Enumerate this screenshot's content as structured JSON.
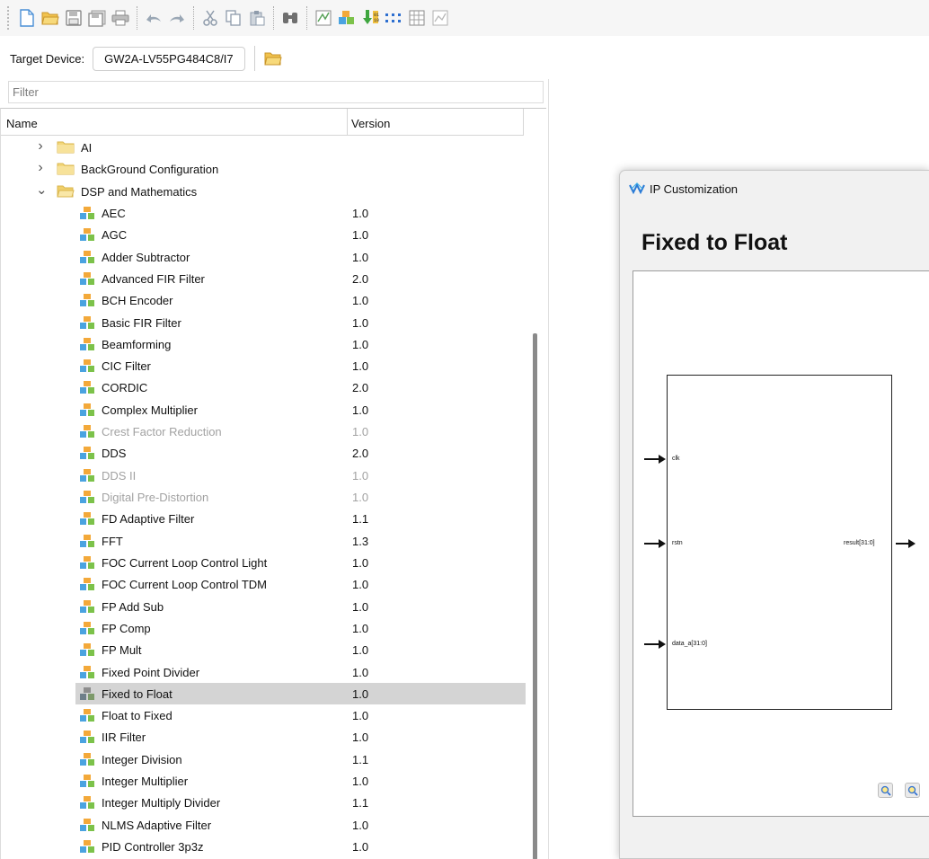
{
  "toolbar": {
    "icons": [
      "new-file-icon",
      "open-folder-icon",
      "save-icon",
      "save-all-icon",
      "print-icon",
      "undo-icon",
      "redo-icon",
      "cut-icon",
      "copy-icon",
      "paste-icon",
      "find-icon",
      "ip-core-generator-icon",
      "ip-package-icon",
      "download-bitstream-icon",
      "timing-icon",
      "floorplan-icon",
      "chart-icon"
    ]
  },
  "device": {
    "label": "Target Device:",
    "value": "GW2A-LV55PG484C8/I7"
  },
  "filter": {
    "placeholder": "Filter",
    "value": ""
  },
  "tree": {
    "columns": {
      "name": "Name",
      "version": "Version"
    },
    "folders": [
      {
        "label": "AI",
        "expanded": false
      },
      {
        "label": "BackGround Configuration",
        "expanded": false
      },
      {
        "label": "DSP and Mathematics",
        "expanded": true
      }
    ],
    "items": [
      {
        "name": "AEC",
        "version": "1.0",
        "disabled": false
      },
      {
        "name": "AGC",
        "version": "1.0",
        "disabled": false
      },
      {
        "name": "Adder Subtractor",
        "version": "1.0",
        "disabled": false
      },
      {
        "name": "Advanced FIR Filter",
        "version": "2.0",
        "disabled": false
      },
      {
        "name": "BCH Encoder",
        "version": "1.0",
        "disabled": false
      },
      {
        "name": "Basic FIR Filter",
        "version": "1.0",
        "disabled": false
      },
      {
        "name": "Beamforming",
        "version": "1.0",
        "disabled": false
      },
      {
        "name": "CIC Filter",
        "version": "1.0",
        "disabled": false
      },
      {
        "name": "CORDIC",
        "version": "2.0",
        "disabled": false
      },
      {
        "name": "Complex Multiplier",
        "version": "1.0",
        "disabled": false
      },
      {
        "name": "Crest Factor Reduction",
        "version": "1.0",
        "disabled": true
      },
      {
        "name": "DDS",
        "version": "2.0",
        "disabled": false
      },
      {
        "name": "DDS II",
        "version": "1.0",
        "disabled": true
      },
      {
        "name": "Digital Pre-Distortion",
        "version": "1.0",
        "disabled": true
      },
      {
        "name": "FD Adaptive Filter",
        "version": "1.1",
        "disabled": false
      },
      {
        "name": "FFT",
        "version": "1.3",
        "disabled": false
      },
      {
        "name": "FOC Current Loop Control Light",
        "version": "1.0",
        "disabled": false
      },
      {
        "name": "FOC Current Loop Control TDM",
        "version": "1.0",
        "disabled": false
      },
      {
        "name": "FP Add Sub",
        "version": "1.0",
        "disabled": false
      },
      {
        "name": "FP Comp",
        "version": "1.0",
        "disabled": false
      },
      {
        "name": "FP Mult",
        "version": "1.0",
        "disabled": false
      },
      {
        "name": "Fixed Point Divider",
        "version": "1.0",
        "disabled": false
      },
      {
        "name": "Fixed to Float",
        "version": "1.0",
        "disabled": false,
        "selected": true
      },
      {
        "name": "Float to Fixed",
        "version": "1.0",
        "disabled": false
      },
      {
        "name": "IIR Filter",
        "version": "1.0",
        "disabled": false
      },
      {
        "name": "Integer Division",
        "version": "1.1",
        "disabled": false
      },
      {
        "name": "Integer Multiplier",
        "version": "1.0",
        "disabled": false
      },
      {
        "name": "Integer Multiply Divider",
        "version": "1.1",
        "disabled": false
      },
      {
        "name": "NLMS Adaptive Filter",
        "version": "1.0",
        "disabled": false
      },
      {
        "name": "PID Controller 3p3z",
        "version": "1.0",
        "disabled": false
      }
    ]
  },
  "ip_customization": {
    "window_title": "IP Customization",
    "heading": "Fixed to Float",
    "ports_in": [
      "clk",
      "rstn",
      "data_a[31:0]"
    ],
    "ports_out": [
      "result[31:0]"
    ],
    "zoom_buttons": [
      "zoom-in-icon",
      "zoom-out-icon"
    ]
  },
  "colors": {
    "selection": "#d4d4d4",
    "folder": "#f3d77b",
    "disabled_text": "#a2a2a2"
  }
}
